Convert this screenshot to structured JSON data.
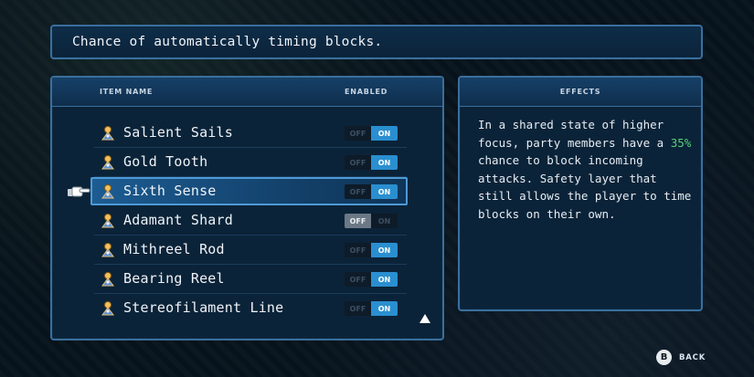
{
  "tooltip": {
    "text": "Chance of automatically timing blocks."
  },
  "list": {
    "col_item_name": "ITEM NAME",
    "col_enabled": "ENABLED",
    "items": [
      {
        "name": "Salient Sails",
        "enabled": true,
        "selected": false
      },
      {
        "name": "Gold Tooth",
        "enabled": true,
        "selected": false
      },
      {
        "name": "Sixth Sense",
        "enabled": true,
        "selected": true
      },
      {
        "name": "Adamant Shard",
        "enabled": false,
        "selected": false
      },
      {
        "name": "Mithreel Rod",
        "enabled": true,
        "selected": false
      },
      {
        "name": "Bearing Reel",
        "enabled": true,
        "selected": false
      },
      {
        "name": "Stereofilament Line",
        "enabled": true,
        "selected": false
      }
    ],
    "toggle_off_label": "OFF",
    "toggle_on_label": "ON",
    "item_icon": "relic-icon",
    "scroll_icon": "scroll-up-arrow-icon",
    "cursor_icon": "pointing-hand-icon"
  },
  "effects": {
    "title": "EFFECTS",
    "text_before": "In a shared state of higher focus, party members have a ",
    "highlight": "35%",
    "text_after": " chance to block incoming attacks. Safety layer that still allows the player to time blocks on their own.",
    "highlight_color": "#56d17a"
  },
  "footer": {
    "button_glyph": "B",
    "back_label": "BACK"
  },
  "colors": {
    "panel_border": "#3a6f9c",
    "toggle_on": "#2a8fd0",
    "selection": "#4e9ad6"
  }
}
